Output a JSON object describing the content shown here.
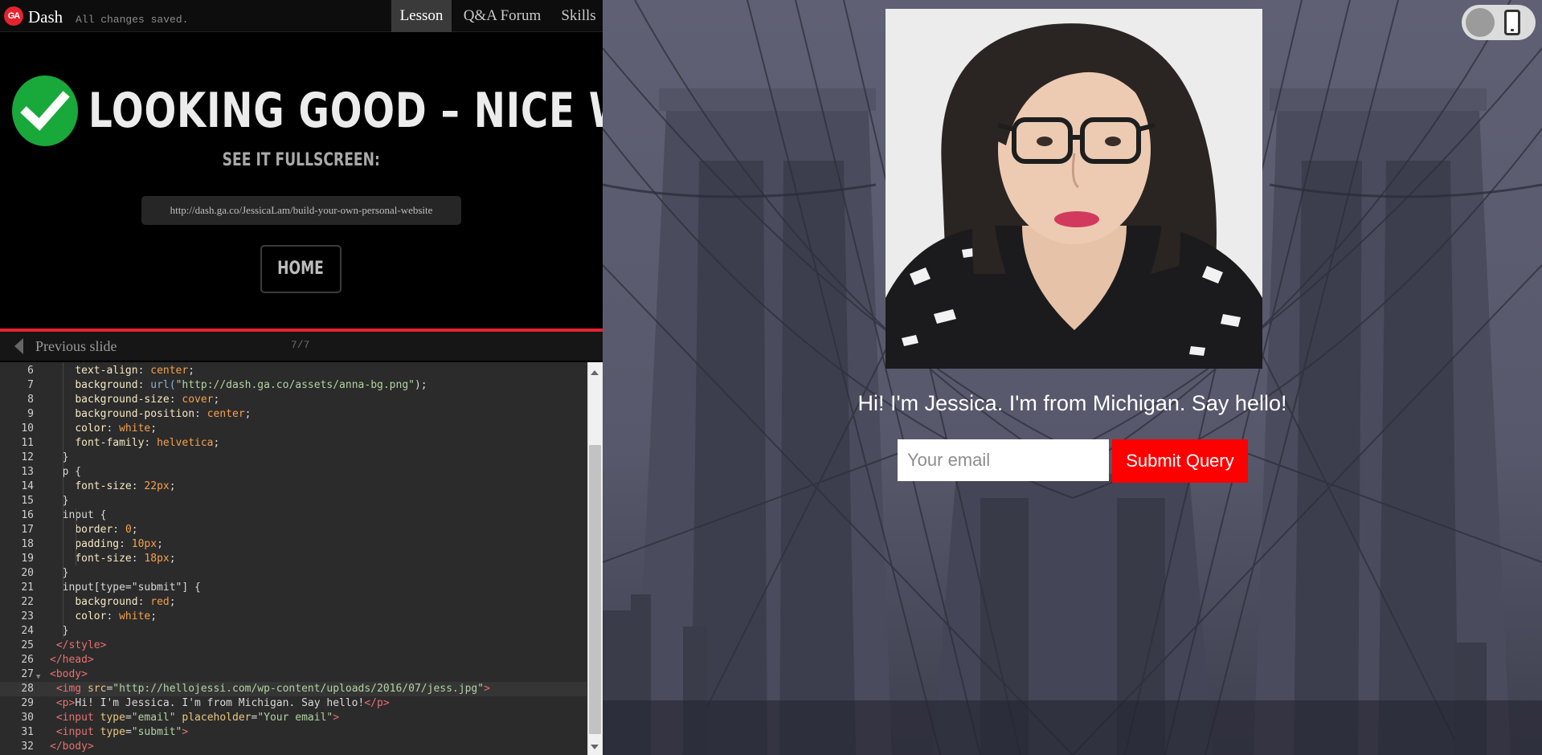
{
  "topbar": {
    "logo_text": "GA",
    "app_name": "Dash",
    "save_status": "All changes saved.",
    "tabs": [
      {
        "label": "Lesson",
        "active": true
      },
      {
        "label": "Q&A Forum",
        "active": false
      },
      {
        "label": "Skills",
        "active": false
      }
    ]
  },
  "lesson": {
    "success_title": "LOOKING GOOD – NICE WORK!",
    "fullscreen_label": "SEE IT FULLSCREEN:",
    "fullscreen_url": "http://dash.ga.co/JessicaLam/build-your-own-personal-website",
    "home_label": "HOME"
  },
  "slidebar": {
    "prev_label": "Previous slide",
    "counter": "7/7"
  },
  "editor": {
    "active_line": 28,
    "lines": [
      {
        "n": "6",
        "parts": [
          [
            "    ",
            "txt"
          ],
          [
            "text-align",
            "prop"
          ],
          [
            ": ",
            "txt"
          ],
          [
            "center",
            "val"
          ],
          [
            ";",
            "txt"
          ]
        ]
      },
      {
        "n": "7",
        "parts": [
          [
            "    ",
            "txt"
          ],
          [
            "background",
            "prop"
          ],
          [
            ": ",
            "txt"
          ],
          [
            "url(",
            "fn"
          ],
          [
            "\"http://dash.ga.co/assets/anna-bg.png\"",
            "str"
          ],
          [
            ");",
            "txt"
          ]
        ]
      },
      {
        "n": "8",
        "parts": [
          [
            "    ",
            "txt"
          ],
          [
            "background-size",
            "prop"
          ],
          [
            ": ",
            "txt"
          ],
          [
            "cover",
            "val"
          ],
          [
            ";",
            "txt"
          ]
        ]
      },
      {
        "n": "9",
        "parts": [
          [
            "    ",
            "txt"
          ],
          [
            "background-position",
            "prop"
          ],
          [
            ": ",
            "txt"
          ],
          [
            "center",
            "val"
          ],
          [
            ";",
            "txt"
          ]
        ]
      },
      {
        "n": "10",
        "parts": [
          [
            "    ",
            "txt"
          ],
          [
            "color",
            "prop"
          ],
          [
            ": ",
            "txt"
          ],
          [
            "white",
            "val"
          ],
          [
            ";",
            "txt"
          ]
        ]
      },
      {
        "n": "11",
        "parts": [
          [
            "    ",
            "txt"
          ],
          [
            "font-family",
            "prop"
          ],
          [
            ": ",
            "txt"
          ],
          [
            "helvetica",
            "val"
          ],
          [
            ";",
            "txt"
          ]
        ]
      },
      {
        "n": "12",
        "parts": [
          [
            "  }",
            "txt"
          ]
        ]
      },
      {
        "n": "13",
        "parts": [
          [
            "  p {",
            "txt"
          ]
        ]
      },
      {
        "n": "14",
        "parts": [
          [
            "    ",
            "txt"
          ],
          [
            "font-size",
            "prop"
          ],
          [
            ": ",
            "txt"
          ],
          [
            "22px",
            "val"
          ],
          [
            ";",
            "txt"
          ]
        ]
      },
      {
        "n": "15",
        "parts": [
          [
            "  }",
            "txt"
          ]
        ]
      },
      {
        "n": "16",
        "parts": [
          [
            "  input {",
            "txt"
          ]
        ]
      },
      {
        "n": "17",
        "parts": [
          [
            "    ",
            "txt"
          ],
          [
            "border",
            "prop"
          ],
          [
            ": ",
            "txt"
          ],
          [
            "0",
            "val"
          ],
          [
            ";",
            "txt"
          ]
        ]
      },
      {
        "n": "18",
        "parts": [
          [
            "    ",
            "txt"
          ],
          [
            "padding",
            "prop"
          ],
          [
            ": ",
            "txt"
          ],
          [
            "10px",
            "val"
          ],
          [
            ";",
            "txt"
          ]
        ]
      },
      {
        "n": "19",
        "parts": [
          [
            "    ",
            "txt"
          ],
          [
            "font-size",
            "prop"
          ],
          [
            ": ",
            "txt"
          ],
          [
            "18px",
            "val"
          ],
          [
            ";",
            "txt"
          ]
        ]
      },
      {
        "n": "20",
        "parts": [
          [
            "  }",
            "txt"
          ]
        ]
      },
      {
        "n": "21",
        "parts": [
          [
            "  input[type=\"submit\"] {",
            "txt"
          ]
        ]
      },
      {
        "n": "22",
        "parts": [
          [
            "    ",
            "txt"
          ],
          [
            "background",
            "prop"
          ],
          [
            ": ",
            "txt"
          ],
          [
            "red",
            "val"
          ],
          [
            ";",
            "txt"
          ]
        ]
      },
      {
        "n": "23",
        "parts": [
          [
            "    ",
            "txt"
          ],
          [
            "color",
            "prop"
          ],
          [
            ": ",
            "txt"
          ],
          [
            "white",
            "val"
          ],
          [
            ";",
            "txt"
          ]
        ]
      },
      {
        "n": "24",
        "parts": [
          [
            "  }",
            "txt"
          ]
        ]
      },
      {
        "n": "25",
        "parts": [
          [
            " ",
            "txt"
          ],
          [
            "</style>",
            "tag"
          ]
        ]
      },
      {
        "n": "26",
        "parts": [
          [
            "</head>",
            "tag"
          ]
        ]
      },
      {
        "n": "27",
        "parts": [
          [
            "<body>",
            "tag"
          ]
        ]
      },
      {
        "n": "28",
        "parts": [
          [
            " ",
            "txt"
          ],
          [
            "<img ",
            "tag"
          ],
          [
            "src",
            "attr"
          ],
          [
            "=",
            "txt"
          ],
          [
            "\"http://hellojessi.com/wp-content/uploads/2016/07/jess.jpg\"",
            "str"
          ],
          [
            ">",
            "tag"
          ]
        ]
      },
      {
        "n": "29",
        "parts": [
          [
            " ",
            "txt"
          ],
          [
            "<p>",
            "tag"
          ],
          [
            "Hi! I'm Jessica. I'm from Michigan. Say hello!",
            "txt"
          ],
          [
            "</p>",
            "tag"
          ]
        ]
      },
      {
        "n": "30",
        "parts": [
          [
            " ",
            "txt"
          ],
          [
            "<input ",
            "tag"
          ],
          [
            "type",
            "attr"
          ],
          [
            "=",
            "txt"
          ],
          [
            "\"email\"",
            "str"
          ],
          [
            " ",
            "txt"
          ],
          [
            "placeholder",
            "attr"
          ],
          [
            "=",
            "txt"
          ],
          [
            "\"Your email\"",
            "str"
          ],
          [
            ">",
            "tag"
          ]
        ]
      },
      {
        "n": "31",
        "parts": [
          [
            " ",
            "txt"
          ],
          [
            "<input ",
            "tag"
          ],
          [
            "type",
            "attr"
          ],
          [
            "=",
            "txt"
          ],
          [
            "\"submit\"",
            "str"
          ],
          [
            ">",
            "tag"
          ]
        ]
      },
      {
        "n": "32",
        "parts": [
          [
            "</body>",
            "tag"
          ]
        ]
      }
    ]
  },
  "preview": {
    "intro": "Hi! I'm Jessica. I'm from Michigan. Say hello!",
    "email_placeholder": "Your email",
    "submit_label": "Submit Query"
  },
  "colors": {
    "brand_red": "#e5232e",
    "success_green": "#19a83a",
    "submit_red": "#ff0000"
  }
}
